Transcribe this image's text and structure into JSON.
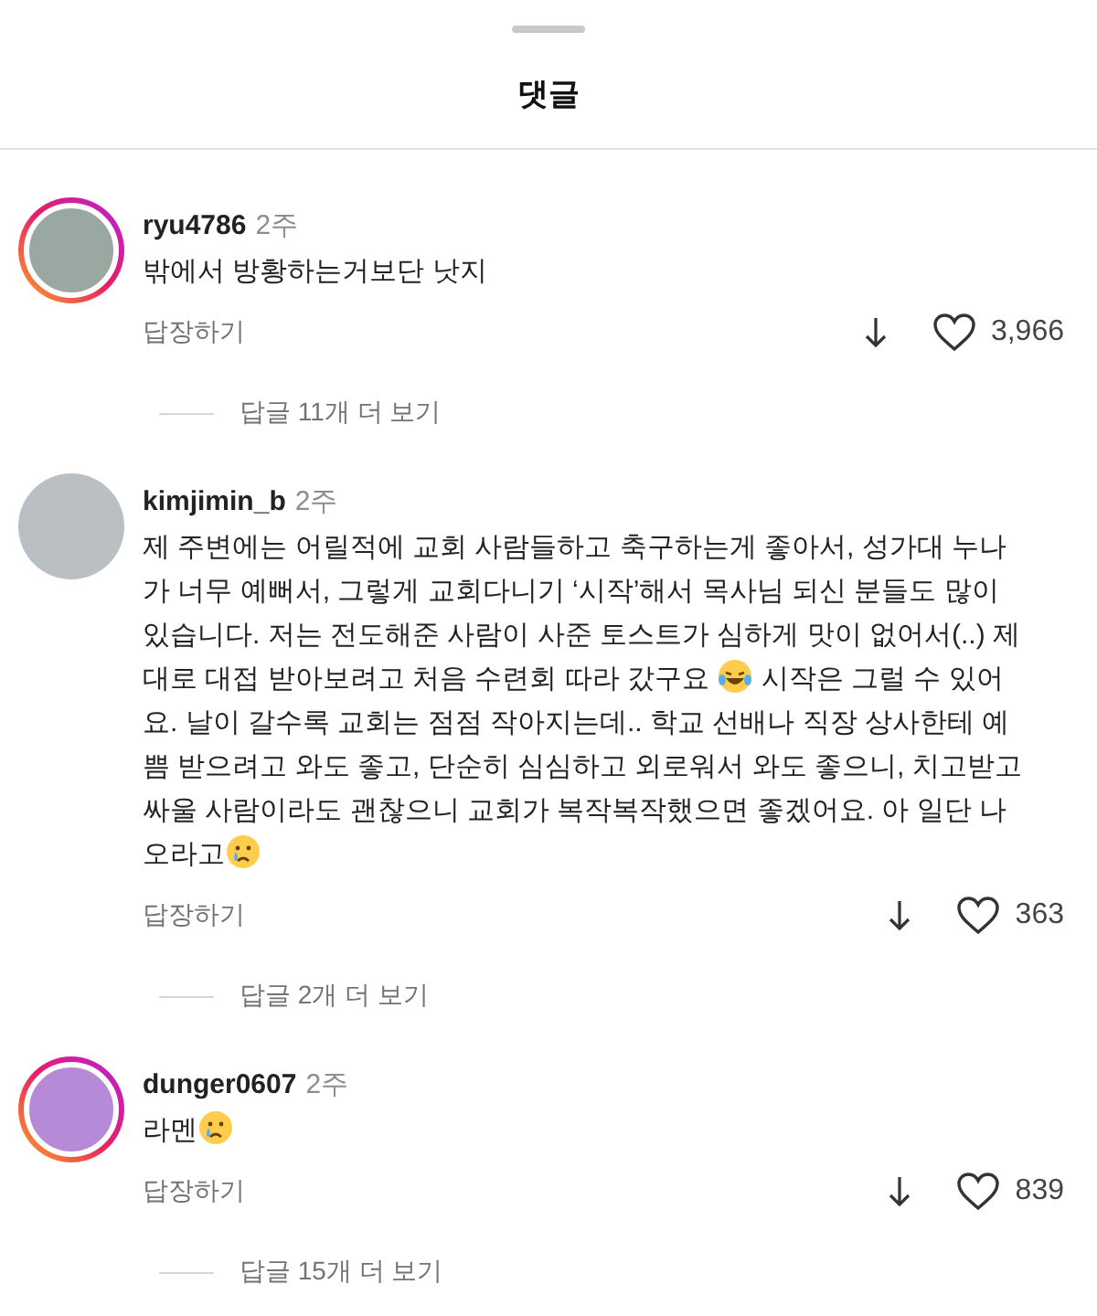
{
  "sheet": {
    "title": "댓글"
  },
  "comments": [
    {
      "username": "ryu4786",
      "time": "2주",
      "story_ring": true,
      "body": [
        {
          "kind": "text",
          "text": "밖에서 방황하는거보단 낫지"
        }
      ],
      "reply_label": "답장하기",
      "likes": "3,966",
      "more_replies": "답글 11개 더 보기"
    },
    {
      "username": "kimjimin_b",
      "time": "2주",
      "story_ring": false,
      "body": [
        {
          "kind": "text",
          "text": "제 주변에는 어릴적에 교회 사람들하고 축구하는게 좋아서, 성가대 누나가 너무 예뻐서, 그렇게 교회다니기 ‘시작’해서 목사님 되신 분들도 많이 있습니다. 저는 전도해준 사람이 사준 토스트가 심하게 맛이 없어서(..) 제대로 대접 받아보려고 처음 수련회 따라 갔구요 "
        },
        {
          "kind": "laugh"
        },
        {
          "kind": "text",
          "text": " 시작은 그럴 수 있어요. 날이 갈수록 교회는 점점 작아지는데.. 학교 선배나 직장 상사한테 예쁨 받으려고 와도 좋고, 단순히 심심하고 외로워서 와도 좋으니, 치고받고 싸울 사람이라도 괜찮으니 교회가 복작복작했으면 좋겠어요. 아 일단 나오라고"
        },
        {
          "kind": "cry"
        }
      ],
      "reply_label": "답장하기",
      "likes": "363",
      "more_replies": "답글 2개 더 보기"
    },
    {
      "username": "dunger0607",
      "time": "2주",
      "story_ring": true,
      "body": [
        {
          "kind": "text",
          "text": "라멘"
        },
        {
          "kind": "cry"
        }
      ],
      "reply_label": "답장하기",
      "likes": "839",
      "more_replies": "답글 15개 더 보기"
    }
  ]
}
